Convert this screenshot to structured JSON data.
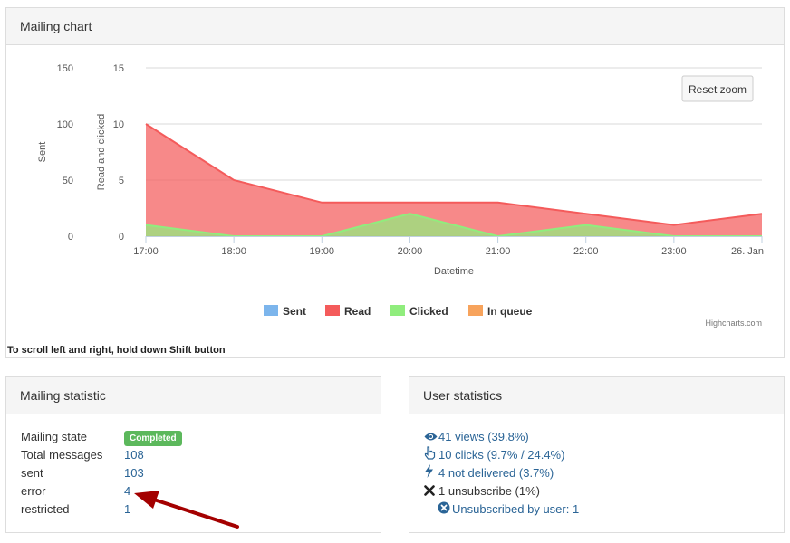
{
  "chart_panel": {
    "title": "Mailing chart",
    "scroll_note": "To scroll left and right, hold down Shift button",
    "reset_zoom_label": "Reset zoom",
    "credits": "Highcharts.com"
  },
  "chart_data": {
    "type": "area",
    "xlabel": "Datetime",
    "x": [
      "17:00",
      "18:00",
      "19:00",
      "20:00",
      "21:00",
      "22:00",
      "23:00",
      "26. Jan"
    ],
    "y_axes": [
      {
        "label": "Sent",
        "ticks": [
          0,
          50,
          100,
          150
        ],
        "range": [
          0,
          150
        ]
      },
      {
        "label": "Read and clicked",
        "ticks": [
          0,
          5,
          10,
          15
        ],
        "range": [
          0,
          15
        ]
      }
    ],
    "series": [
      {
        "name": "Sent",
        "color": "#7cb5ec",
        "values": [
          0,
          0,
          0,
          0,
          0,
          0,
          0,
          0
        ]
      },
      {
        "name": "Read",
        "color": "#f45b5b",
        "values": [
          10,
          5,
          3,
          3,
          3,
          2,
          1,
          2
        ]
      },
      {
        "name": "Clicked",
        "color": "#90ed7d",
        "values": [
          1,
          0,
          0,
          2,
          0,
          1,
          0,
          0
        ]
      },
      {
        "name": "In queue",
        "color": "#f7a35c",
        "values": [
          0,
          0,
          0,
          0,
          0,
          0,
          0,
          0
        ]
      }
    ],
    "grid": true,
    "legend_position": "bottom-center"
  },
  "mailing_statistic": {
    "title": "Mailing statistic",
    "rows": [
      {
        "label": "Mailing state",
        "value": "Completed"
      },
      {
        "label": "Total messages",
        "value": "108"
      },
      {
        "label": "sent",
        "value": "103"
      },
      {
        "label": "error",
        "value": "4"
      },
      {
        "label": "restricted",
        "value": "1"
      }
    ]
  },
  "user_statistics": {
    "title": "User statistics",
    "rows": [
      {
        "icon": "eye-icon",
        "text": "41 views (39.8%)"
      },
      {
        "icon": "hand-pointer-icon",
        "text": "10 clicks (9.7% / 24.4%)"
      },
      {
        "icon": "bolt-icon",
        "text": "4 not delivered (3.7%)"
      },
      {
        "icon": "close-icon",
        "text": "1 unsubscribe (1%)"
      },
      {
        "icon": "circle-x-icon",
        "text": "Unsubscribed by user: 1"
      }
    ]
  },
  "colors": {
    "accent_link": "#2a6496",
    "badge_success": "#5cb85c",
    "arrow": "#a40000"
  }
}
